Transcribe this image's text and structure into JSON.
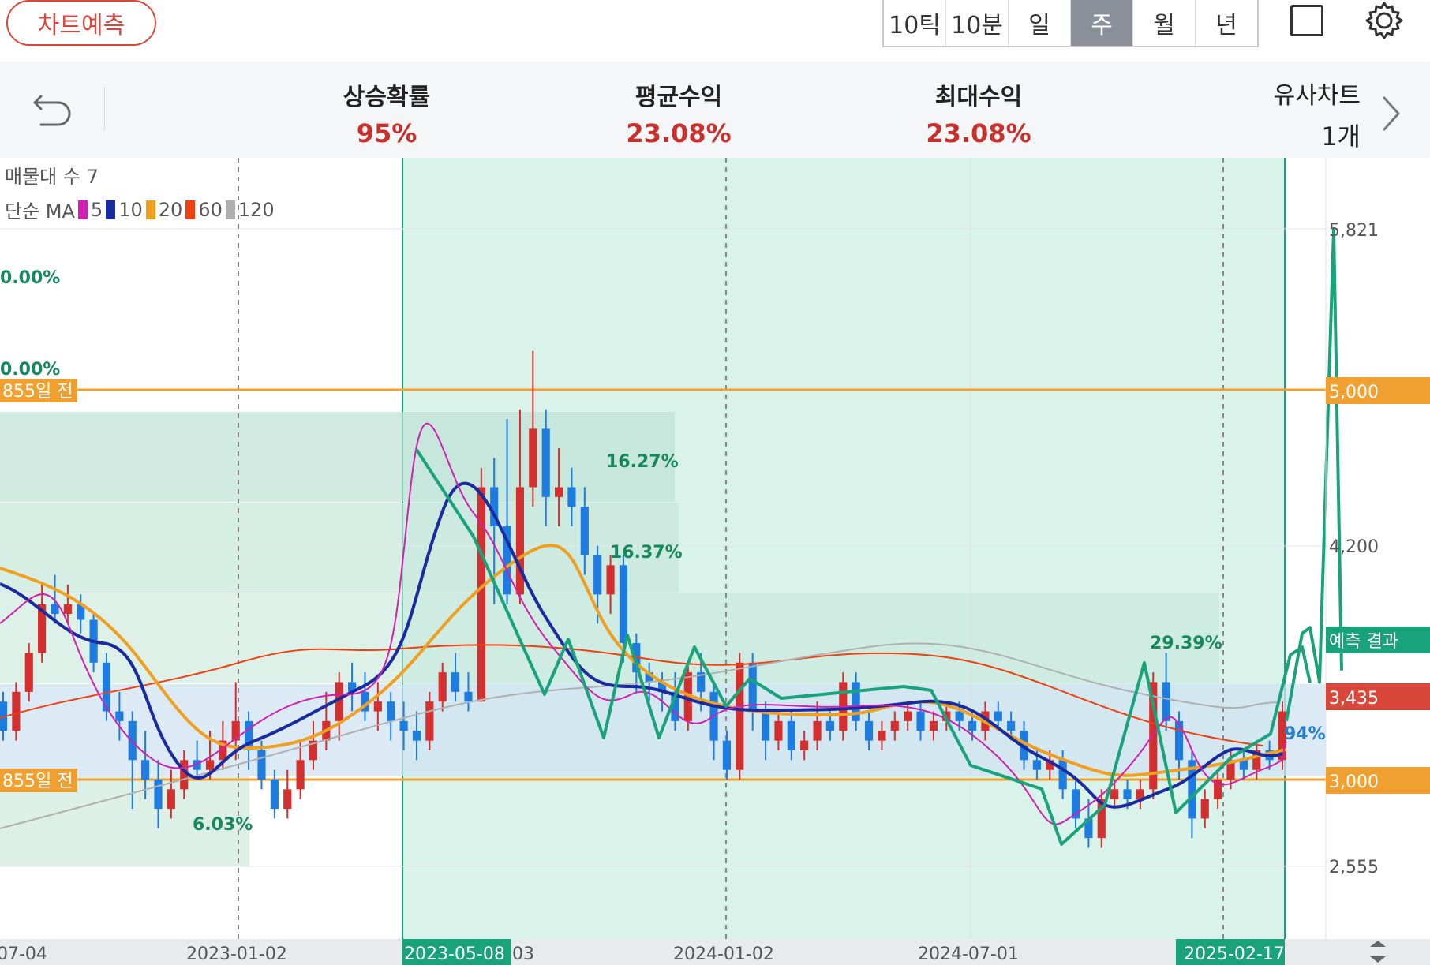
{
  "header": {
    "predict_button": "차트예측",
    "periods": [
      "10틱",
      "10분",
      "일",
      "주",
      "월",
      "년"
    ],
    "active_period": "주"
  },
  "stats": {
    "up_prob_label": "상승확률",
    "up_prob_value": "95%",
    "avg_return_label": "평균수익",
    "avg_return_value": "23.08%",
    "max_return_label": "최대수익",
    "max_return_value": "23.08%",
    "similar_label": "유사차트",
    "similar_value": "1개"
  },
  "legend": {
    "volume_profile": "매물대 수 7",
    "ma_label": "단순 MA",
    "ma_periods": [
      {
        "period": "5",
        "color": "#d020b0"
      },
      {
        "period": "10",
        "color": "#1a2aa0"
      },
      {
        "period": "20",
        "color": "#f0a020"
      },
      {
        "period": "60",
        "color": "#f04010"
      },
      {
        "period": "120",
        "color": "#b0b0b0"
      }
    ]
  },
  "colors": {
    "up_candle": "#d32f2f",
    "down_candle": "#1e7be0",
    "pattern_line": "#1aa37a",
    "similar_region": "#cdeee2",
    "level_line": "#f0a030",
    "price_badge": "#d9473b"
  },
  "chart_data": {
    "type": "candlestick",
    "x_ticks": [
      "07-04",
      "2023-01-02",
      "2023-05-08",
      "03",
      "2024-01-02",
      "2024-07-01",
      "2025-02-17"
    ],
    "y_ticks": [
      "5,821",
      "5,000",
      "4,200",
      "3,435",
      "3,000",
      "2,555"
    ],
    "y_range": [
      2400,
      6000
    ],
    "current_price": "3,435",
    "prediction_label": "예측 결과",
    "levels": [
      {
        "value": 5000,
        "label": "5,000",
        "tag": "855일 전"
      },
      {
        "value": 3000,
        "label": "3,000",
        "tag": "855일 전"
      }
    ],
    "profile_pcts": [
      "0.00%",
      "0.00%",
      "16.27%",
      "16.37%",
      "29.39%",
      "6.03%"
    ],
    "last_pct": "94%",
    "similar_start": "2023-05-08",
    "similar_end": "2025-02-17",
    "forecast": [
      3300,
      3750,
      3780,
      3500,
      5821,
      3560
    ],
    "candles": [
      [
        3400,
        3250,
        3450,
        3200
      ],
      [
        3250,
        3450,
        3500,
        3200
      ],
      [
        3450,
        3650,
        3700,
        3400
      ],
      [
        3650,
        3900,
        4000,
        3600
      ],
      [
        3900,
        3850,
        4050,
        3800
      ],
      [
        3850,
        3900,
        4000,
        3800
      ],
      [
        3900,
        3820,
        3950,
        3750
      ],
      [
        3820,
        3600,
        3850,
        3550
      ],
      [
        3600,
        3350,
        3650,
        3300
      ],
      [
        3350,
        3300,
        3450,
        3200
      ],
      [
        3300,
        3100,
        3350,
        2850
      ],
      [
        3100,
        3000,
        3250,
        2900
      ],
      [
        3000,
        2850,
        3100,
        2750
      ],
      [
        2850,
        2950,
        3050,
        2800
      ],
      [
        2950,
        3100,
        3150,
        2900
      ],
      [
        3100,
        3050,
        3200,
        3000
      ],
      [
        3050,
        3100,
        3250,
        3000
      ],
      [
        3100,
        3200,
        3300,
        3050
      ],
      [
        3200,
        3300,
        3500,
        3100
      ],
      [
        3300,
        3150,
        3350,
        3050
      ],
      [
        3150,
        3000,
        3200,
        2950
      ],
      [
        3000,
        2850,
        3050,
        2800
      ],
      [
        2850,
        2950,
        3050,
        2800
      ],
      [
        2950,
        3100,
        3200,
        2900
      ],
      [
        3100,
        3200,
        3300,
        3050
      ],
      [
        3200,
        3300,
        3450,
        3150
      ],
      [
        3300,
        3500,
        3550,
        3200
      ],
      [
        3500,
        3450,
        3600,
        3350
      ],
      [
        3450,
        3350,
        3550,
        3300
      ],
      [
        3350,
        3400,
        3500,
        3250
      ],
      [
        3400,
        3300,
        3450,
        3200
      ],
      [
        3300,
        3250,
        3400,
        3150
      ],
      [
        3250,
        3200,
        3350,
        3100
      ],
      [
        3200,
        3400,
        3450,
        3150
      ],
      [
        3400,
        3550,
        3600,
        3350
      ],
      [
        3550,
        3450,
        3650,
        3400
      ],
      [
        3450,
        3400,
        3550,
        3350
      ],
      [
        3400,
        4500,
        4600,
        3400
      ],
      [
        4500,
        4300,
        4650,
        3900
      ],
      [
        4300,
        3950,
        4850,
        3900
      ],
      [
        3950,
        4500,
        4900,
        3900
      ],
      [
        4500,
        4800,
        5200,
        4400
      ],
      [
        4800,
        4450,
        4900,
        4300
      ],
      [
        4450,
        4500,
        4700,
        4300
      ],
      [
        4500,
        4400,
        4600,
        4300
      ],
      [
        4400,
        4150,
        4500,
        4050
      ],
      [
        4150,
        3950,
        4200,
        3800
      ],
      [
        3950,
        4100,
        4150,
        3850
      ],
      [
        4100,
        3700,
        4150,
        3600
      ],
      [
        3700,
        3550,
        3750,
        3450
      ],
      [
        3550,
        3500,
        3600,
        3400
      ],
      [
        3500,
        3450,
        3550,
        3350
      ],
      [
        3450,
        3300,
        3550,
        3250
      ],
      [
        3300,
        3550,
        3600,
        3250
      ],
      [
        3550,
        3450,
        3650,
        3350
      ],
      [
        3450,
        3200,
        3500,
        3100
      ],
      [
        3200,
        3050,
        3250,
        3000
      ],
      [
        3050,
        3600,
        3650,
        3000
      ],
      [
        3600,
        3350,
        3650,
        3250
      ],
      [
        3350,
        3200,
        3400,
        3100
      ],
      [
        3200,
        3300,
        3350,
        3150
      ],
      [
        3300,
        3150,
        3350,
        3100
      ],
      [
        3150,
        3200,
        3250,
        3100
      ],
      [
        3200,
        3300,
        3400,
        3150
      ],
      [
        3300,
        3250,
        3350,
        3200
      ],
      [
        3250,
        3500,
        3550,
        3200
      ],
      [
        3500,
        3300,
        3550,
        3250
      ],
      [
        3300,
        3200,
        3350,
        3150
      ],
      [
        3200,
        3250,
        3300,
        3150
      ],
      [
        3250,
        3300,
        3350,
        3200
      ],
      [
        3300,
        3350,
        3400,
        3250
      ],
      [
        3350,
        3250,
        3400,
        3200
      ],
      [
        3250,
        3300,
        3350,
        3200
      ],
      [
        3300,
        3350,
        3400,
        3250
      ],
      [
        3350,
        3300,
        3400,
        3250
      ],
      [
        3300,
        3250,
        3350,
        3200
      ],
      [
        3250,
        3350,
        3400,
        3200
      ],
      [
        3350,
        3300,
        3400,
        3250
      ],
      [
        3300,
        3250,
        3350,
        3200
      ],
      [
        3250,
        3100,
        3300,
        3050
      ],
      [
        3100,
        3050,
        3150,
        3000
      ],
      [
        3050,
        3100,
        3150,
        3000
      ],
      [
        3100,
        2950,
        3150,
        2900
      ],
      [
        2950,
        2800,
        3000,
        2750
      ],
      [
        2800,
        2700,
        2900,
        2650
      ],
      [
        2700,
        2900,
        2950,
        2650
      ],
      [
        2900,
        2950,
        3000,
        2850
      ],
      [
        2950,
        2900,
        3000,
        2850
      ],
      [
        2900,
        2950,
        3000,
        2850
      ],
      [
        2950,
        3500,
        3550,
        2900
      ],
      [
        3500,
        3300,
        3650,
        3250
      ],
      [
        3300,
        3100,
        3350,
        3000
      ],
      [
        3100,
        2800,
        3150,
        2700
      ],
      [
        2800,
        2900,
        2950,
        2750
      ],
      [
        2900,
        3000,
        3050,
        2850
      ],
      [
        3000,
        3100,
        3150,
        2950
      ],
      [
        3100,
        3050,
        3150,
        3000
      ],
      [
        3050,
        3150,
        3200,
        3000
      ],
      [
        3150,
        3100,
        3200,
        3050
      ],
      [
        3100,
        3350,
        3400,
        3050
      ]
    ]
  }
}
